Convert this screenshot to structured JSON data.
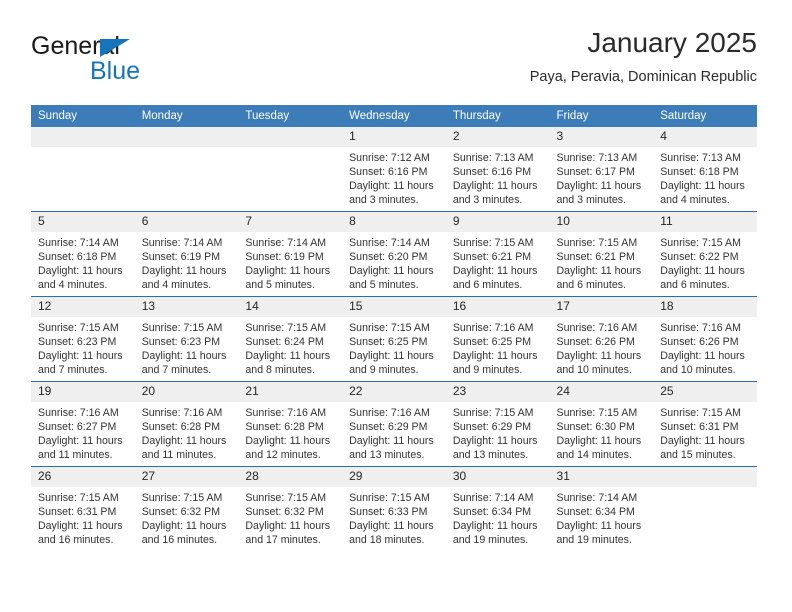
{
  "brand": {
    "word_one": "General",
    "word_two": "Blue",
    "accent_color": "#1574bb",
    "icon": "triangle-logo-icon"
  },
  "header": {
    "title": "January 2025",
    "subtitle": "Paya, Peravia, Dominican Republic"
  },
  "theme": {
    "header_blue": "#3c7cb8",
    "row_divider_blue": "#2e6da4",
    "daynum_band": "#efefef"
  },
  "calendar": {
    "weekday_headers": [
      "Sunday",
      "Monday",
      "Tuesday",
      "Wednesday",
      "Thursday",
      "Friday",
      "Saturday"
    ],
    "weeks": [
      [
        {
          "day": "",
          "lines": []
        },
        {
          "day": "",
          "lines": []
        },
        {
          "day": "",
          "lines": []
        },
        {
          "day": "1",
          "lines": [
            "Sunrise: 7:12 AM",
            "Sunset: 6:16 PM",
            "Daylight: 11 hours",
            "and 3 minutes."
          ]
        },
        {
          "day": "2",
          "lines": [
            "Sunrise: 7:13 AM",
            "Sunset: 6:16 PM",
            "Daylight: 11 hours",
            "and 3 minutes."
          ]
        },
        {
          "day": "3",
          "lines": [
            "Sunrise: 7:13 AM",
            "Sunset: 6:17 PM",
            "Daylight: 11 hours",
            "and 3 minutes."
          ]
        },
        {
          "day": "4",
          "lines": [
            "Sunrise: 7:13 AM",
            "Sunset: 6:18 PM",
            "Daylight: 11 hours",
            "and 4 minutes."
          ]
        }
      ],
      [
        {
          "day": "5",
          "lines": [
            "Sunrise: 7:14 AM",
            "Sunset: 6:18 PM",
            "Daylight: 11 hours",
            "and 4 minutes."
          ]
        },
        {
          "day": "6",
          "lines": [
            "Sunrise: 7:14 AM",
            "Sunset: 6:19 PM",
            "Daylight: 11 hours",
            "and 4 minutes."
          ]
        },
        {
          "day": "7",
          "lines": [
            "Sunrise: 7:14 AM",
            "Sunset: 6:19 PM",
            "Daylight: 11 hours",
            "and 5 minutes."
          ]
        },
        {
          "day": "8",
          "lines": [
            "Sunrise: 7:14 AM",
            "Sunset: 6:20 PM",
            "Daylight: 11 hours",
            "and 5 minutes."
          ]
        },
        {
          "day": "9",
          "lines": [
            "Sunrise: 7:15 AM",
            "Sunset: 6:21 PM",
            "Daylight: 11 hours",
            "and 6 minutes."
          ]
        },
        {
          "day": "10",
          "lines": [
            "Sunrise: 7:15 AM",
            "Sunset: 6:21 PM",
            "Daylight: 11 hours",
            "and 6 minutes."
          ]
        },
        {
          "day": "11",
          "lines": [
            "Sunrise: 7:15 AM",
            "Sunset: 6:22 PM",
            "Daylight: 11 hours",
            "and 6 minutes."
          ]
        }
      ],
      [
        {
          "day": "12",
          "lines": [
            "Sunrise: 7:15 AM",
            "Sunset: 6:23 PM",
            "Daylight: 11 hours",
            "and 7 minutes."
          ]
        },
        {
          "day": "13",
          "lines": [
            "Sunrise: 7:15 AM",
            "Sunset: 6:23 PM",
            "Daylight: 11 hours",
            "and 7 minutes."
          ]
        },
        {
          "day": "14",
          "lines": [
            "Sunrise: 7:15 AM",
            "Sunset: 6:24 PM",
            "Daylight: 11 hours",
            "and 8 minutes."
          ]
        },
        {
          "day": "15",
          "lines": [
            "Sunrise: 7:15 AM",
            "Sunset: 6:25 PM",
            "Daylight: 11 hours",
            "and 9 minutes."
          ]
        },
        {
          "day": "16",
          "lines": [
            "Sunrise: 7:16 AM",
            "Sunset: 6:25 PM",
            "Daylight: 11 hours",
            "and 9 minutes."
          ]
        },
        {
          "day": "17",
          "lines": [
            "Sunrise: 7:16 AM",
            "Sunset: 6:26 PM",
            "Daylight: 11 hours",
            "and 10 minutes."
          ]
        },
        {
          "day": "18",
          "lines": [
            "Sunrise: 7:16 AM",
            "Sunset: 6:26 PM",
            "Daylight: 11 hours",
            "and 10 minutes."
          ]
        }
      ],
      [
        {
          "day": "19",
          "lines": [
            "Sunrise: 7:16 AM",
            "Sunset: 6:27 PM",
            "Daylight: 11 hours",
            "and 11 minutes."
          ]
        },
        {
          "day": "20",
          "lines": [
            "Sunrise: 7:16 AM",
            "Sunset: 6:28 PM",
            "Daylight: 11 hours",
            "and 11 minutes."
          ]
        },
        {
          "day": "21",
          "lines": [
            "Sunrise: 7:16 AM",
            "Sunset: 6:28 PM",
            "Daylight: 11 hours",
            "and 12 minutes."
          ]
        },
        {
          "day": "22",
          "lines": [
            "Sunrise: 7:16 AM",
            "Sunset: 6:29 PM",
            "Daylight: 11 hours",
            "and 13 minutes."
          ]
        },
        {
          "day": "23",
          "lines": [
            "Sunrise: 7:15 AM",
            "Sunset: 6:29 PM",
            "Daylight: 11 hours",
            "and 13 minutes."
          ]
        },
        {
          "day": "24",
          "lines": [
            "Sunrise: 7:15 AM",
            "Sunset: 6:30 PM",
            "Daylight: 11 hours",
            "and 14 minutes."
          ]
        },
        {
          "day": "25",
          "lines": [
            "Sunrise: 7:15 AM",
            "Sunset: 6:31 PM",
            "Daylight: 11 hours",
            "and 15 minutes."
          ]
        }
      ],
      [
        {
          "day": "26",
          "lines": [
            "Sunrise: 7:15 AM",
            "Sunset: 6:31 PM",
            "Daylight: 11 hours",
            "and 16 minutes."
          ]
        },
        {
          "day": "27",
          "lines": [
            "Sunrise: 7:15 AM",
            "Sunset: 6:32 PM",
            "Daylight: 11 hours",
            "and 16 minutes."
          ]
        },
        {
          "day": "28",
          "lines": [
            "Sunrise: 7:15 AM",
            "Sunset: 6:32 PM",
            "Daylight: 11 hours",
            "and 17 minutes."
          ]
        },
        {
          "day": "29",
          "lines": [
            "Sunrise: 7:15 AM",
            "Sunset: 6:33 PM",
            "Daylight: 11 hours",
            "and 18 minutes."
          ]
        },
        {
          "day": "30",
          "lines": [
            "Sunrise: 7:14 AM",
            "Sunset: 6:34 PM",
            "Daylight: 11 hours",
            "and 19 minutes."
          ]
        },
        {
          "day": "31",
          "lines": [
            "Sunrise: 7:14 AM",
            "Sunset: 6:34 PM",
            "Daylight: 11 hours",
            "and 19 minutes."
          ]
        },
        {
          "day": "",
          "lines": []
        }
      ]
    ]
  }
}
